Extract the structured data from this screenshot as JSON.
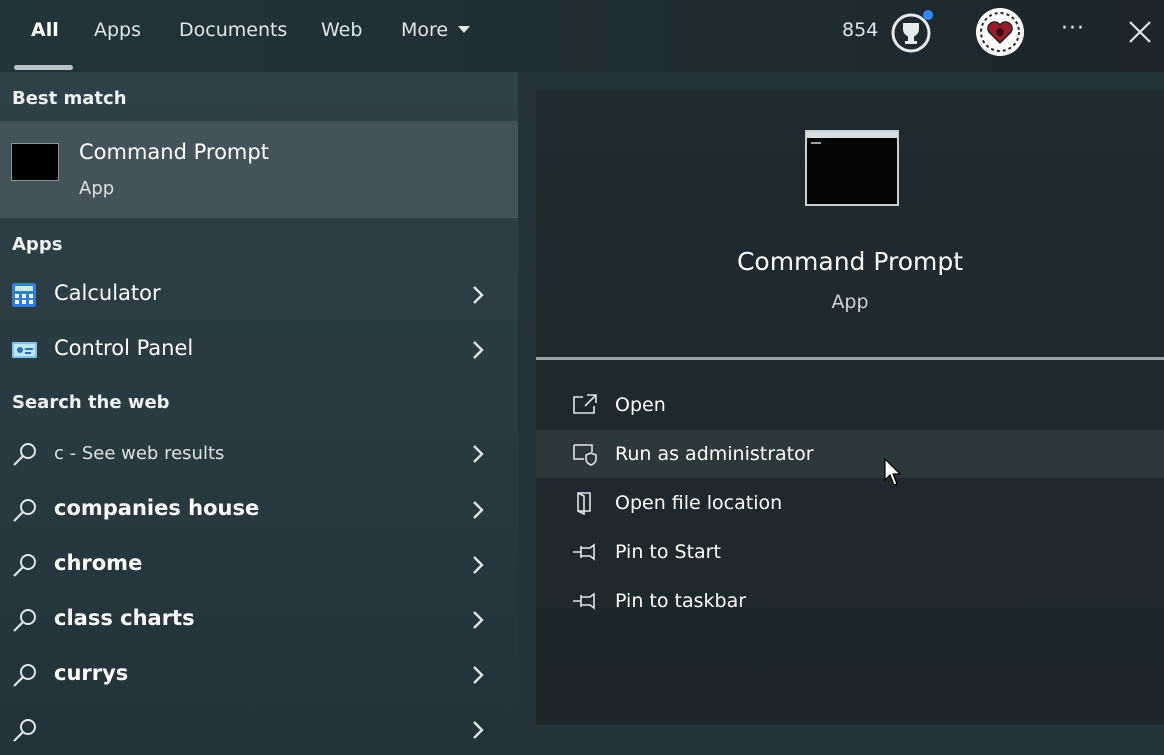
{
  "tabs": [
    {
      "label": "All",
      "active": true
    },
    {
      "label": "Apps",
      "active": false
    },
    {
      "label": "Documents",
      "active": false
    },
    {
      "label": "Web",
      "active": false
    },
    {
      "label": "More",
      "active": false
    }
  ],
  "header": {
    "points": "854",
    "more_icon": "ellipsis-icon",
    "close_icon": "close-icon",
    "notification_color": "#2f8bff"
  },
  "left": {
    "best_match_title": "Best match",
    "best_match": {
      "name": "Command Prompt",
      "type": "App",
      "icon": "command-prompt-icon"
    },
    "apps_title": "Apps",
    "apps": [
      {
        "name": "Calculator",
        "icon": "calculator-icon"
      },
      {
        "name": "Control Panel",
        "icon": "control-panel-icon"
      }
    ],
    "web_title": "Search the web",
    "web": [
      {
        "query": "c",
        "suffix": " - See web results"
      },
      {
        "query": "companies house"
      },
      {
        "query": "chrome"
      },
      {
        "query": "class charts"
      },
      {
        "query": "currys"
      }
    ]
  },
  "right": {
    "app_name": "Command Prompt",
    "app_type": "App",
    "actions": [
      {
        "label": "Open",
        "icon": "open-icon"
      },
      {
        "label": "Run as administrator",
        "icon": "shield-icon",
        "hover": true
      },
      {
        "label": "Open file location",
        "icon": "folder-icon"
      },
      {
        "label": "Pin to Start",
        "icon": "pin-icon"
      },
      {
        "label": "Pin to taskbar",
        "icon": "pin-icon"
      }
    ]
  }
}
